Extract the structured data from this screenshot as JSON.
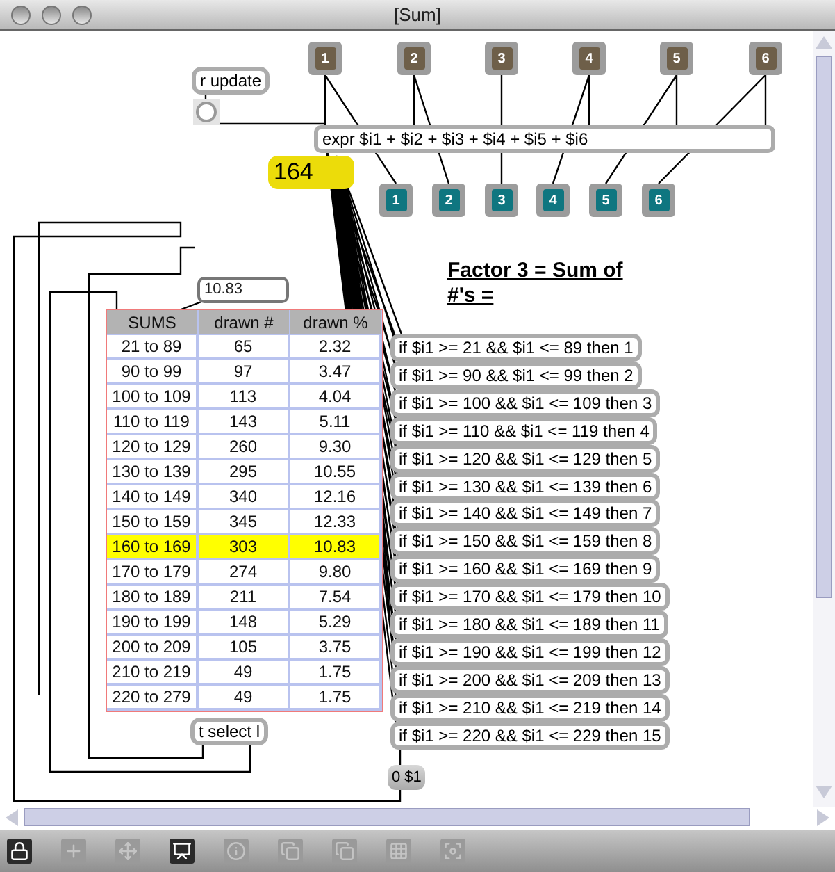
{
  "window": {
    "title": "[Sum]"
  },
  "inlets": [
    "1",
    "2",
    "3",
    "4",
    "5",
    "6"
  ],
  "outlets": [
    "1",
    "2",
    "3",
    "4",
    "5",
    "6"
  ],
  "receive_object": "r update",
  "expr_object": "expr $i1 + $i2 + $i3 + $i4 + $i5 + $i6",
  "number_display": "164",
  "message_value": "10.83",
  "table": {
    "columns": [
      "SUMS",
      "drawn #",
      "drawn %"
    ],
    "rows": [
      {
        "cells": [
          "21 to 89",
          "65",
          "2.32"
        ],
        "selected": false
      },
      {
        "cells": [
          "90 to 99",
          "97",
          "3.47"
        ],
        "selected": false
      },
      {
        "cells": [
          "100 to 109",
          "113",
          "4.04"
        ],
        "selected": false
      },
      {
        "cells": [
          "110 to 119",
          "143",
          "5.11"
        ],
        "selected": false
      },
      {
        "cells": [
          "120 to 129",
          "260",
          "9.30"
        ],
        "selected": false
      },
      {
        "cells": [
          "130 to 139",
          "295",
          "10.55"
        ],
        "selected": false
      },
      {
        "cells": [
          "140 to 149",
          "340",
          "12.16"
        ],
        "selected": false
      },
      {
        "cells": [
          "150 to 159",
          "345",
          "12.33"
        ],
        "selected": false
      },
      {
        "cells": [
          "160 to 169",
          "303",
          "10.83"
        ],
        "selected": true
      },
      {
        "cells": [
          "170 to 179",
          "274",
          "9.80"
        ],
        "selected": false
      },
      {
        "cells": [
          "180 to 189",
          "211",
          "7.54"
        ],
        "selected": false
      },
      {
        "cells": [
          "190 to 199",
          "148",
          "5.29"
        ],
        "selected": false
      },
      {
        "cells": [
          "200 to 209",
          "105",
          "3.75"
        ],
        "selected": false
      },
      {
        "cells": [
          "210 to 219",
          "49",
          "1.75"
        ],
        "selected": false
      },
      {
        "cells": [
          "220 to 279",
          "49",
          "1.75"
        ],
        "selected": false
      }
    ]
  },
  "heading": "Factor 3 = Sum of #'s =",
  "if_objects": [
    "if $i1 >= 21 && $i1 <= 89 then 1",
    "if $i1 >= 90 && $i1 <= 99 then 2",
    "if $i1 >= 100 && $i1 <= 109 then 3",
    "if $i1 >= 110 && $i1 <= 119 then 4",
    "if $i1 >= 120 && $i1 <= 129 then 5",
    "if $i1 >= 130 && $i1 <= 139 then 6",
    "if $i1 >= 140 && $i1 <= 149 then 7",
    "if $i1 >= 150 && $i1 <= 159 then 8",
    "if $i1 >= 160 && $i1 <= 169 then 9",
    "if $i1 >= 170 && $i1 <= 179 then 10",
    "if $i1 >= 180 && $i1 <= 189 then 11",
    "if $i1 >= 190 && $i1 <= 199 then 12",
    "if $i1 >= 200 && $i1 <= 209 then 13",
    "if $i1 >= 210 && $i1 <= 219 then 14",
    "if $i1 >= 220 && $i1 <= 229 then 15"
  ],
  "message_box": "0 $1",
  "trigger_object": "t select l",
  "toolbar": [
    {
      "kind": "lock",
      "on": true
    },
    {
      "kind": "new-object",
      "on": false
    },
    {
      "kind": "move",
      "on": false
    },
    {
      "kind": "presentation",
      "on": true
    },
    {
      "kind": "inspector",
      "on": false
    },
    {
      "kind": "bring-front",
      "on": false
    },
    {
      "kind": "send-back",
      "on": false
    },
    {
      "kind": "grid",
      "on": false
    },
    {
      "kind": "snap",
      "on": false
    }
  ]
}
